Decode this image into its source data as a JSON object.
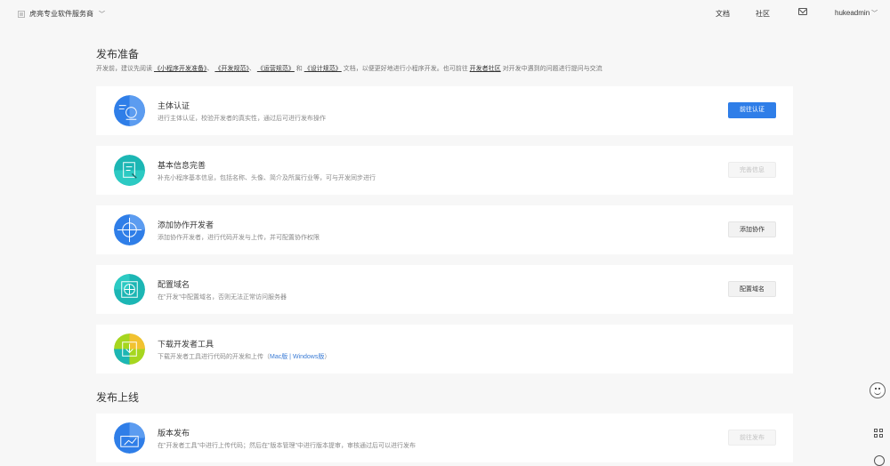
{
  "header": {
    "brand": "虎亮专业软件服务商",
    "brand_chevron": "﹀",
    "nav_docs": "文档",
    "nav_community": "社区",
    "user": "hukeadmin",
    "user_chevron": "﹀"
  },
  "prepare": {
    "title": "发布准备",
    "intro": {
      "p1": "开发前，建议先阅读",
      "l1": "《小程序开发准备》",
      "s1": "、",
      "l2": "《开发规范》",
      "s2": "、",
      "l3": "《运营规范》",
      "s3": " 和 ",
      "l4": "《设计规范》",
      "p2": "文档，以便更好地进行小程序开发。也可前往",
      "l5": "开发者社区",
      "p3": "对开发中遇到的问题进行提问与交流"
    },
    "cards": [
      {
        "title": "主体认证",
        "desc": "进行主体认证，校验开发者的真实性，通过后可进行发布操作",
        "button": "前往认证",
        "icon": "identity-icon",
        "color": "#2f7ee8"
      },
      {
        "title": "基本信息完善",
        "desc": "补充小程序基本信息，包括名称、头像、简介及所属行业等，可与开发同步进行",
        "button": "完善信息",
        "icon": "info-form-icon",
        "color": "#1cb6b4"
      },
      {
        "title": "添加协作开发者",
        "desc": "添加协作开发者，进行代码开发与上传，并可配置协作权限",
        "button": "添加协作",
        "icon": "collaborator-icon",
        "color": "#2f7ee8"
      },
      {
        "title": "配置域名",
        "desc": "在\"开发\"中配置域名，否则无法正常访问服务器",
        "button": "配置域名",
        "icon": "domain-icon",
        "color": "#1cb6b4"
      },
      {
        "title": "下载开发者工具",
        "desc_prefix": "下载开发者工具进行代码的开发和上传（",
        "mac": "Mac版",
        "sep": " | ",
        "win": "Windows版",
        "desc_suffix": "）",
        "icon": "download-icon",
        "color": "#a6d61f"
      }
    ]
  },
  "release": {
    "title": "发布上线",
    "cards": [
      {
        "title": "版本发布",
        "desc": "在\"开发者工具\"中进行上传代码；然后在\"版本管理\"中进行版本提审，审核通过后可以进行发布",
        "button": "前往发布",
        "icon": "version-release-icon",
        "color": "#2f7ee8"
      }
    ]
  },
  "floating": {
    "feedback_icon": "smile-icon",
    "qr_icon": "qrcode-icon",
    "help_icon": "help-icon"
  }
}
